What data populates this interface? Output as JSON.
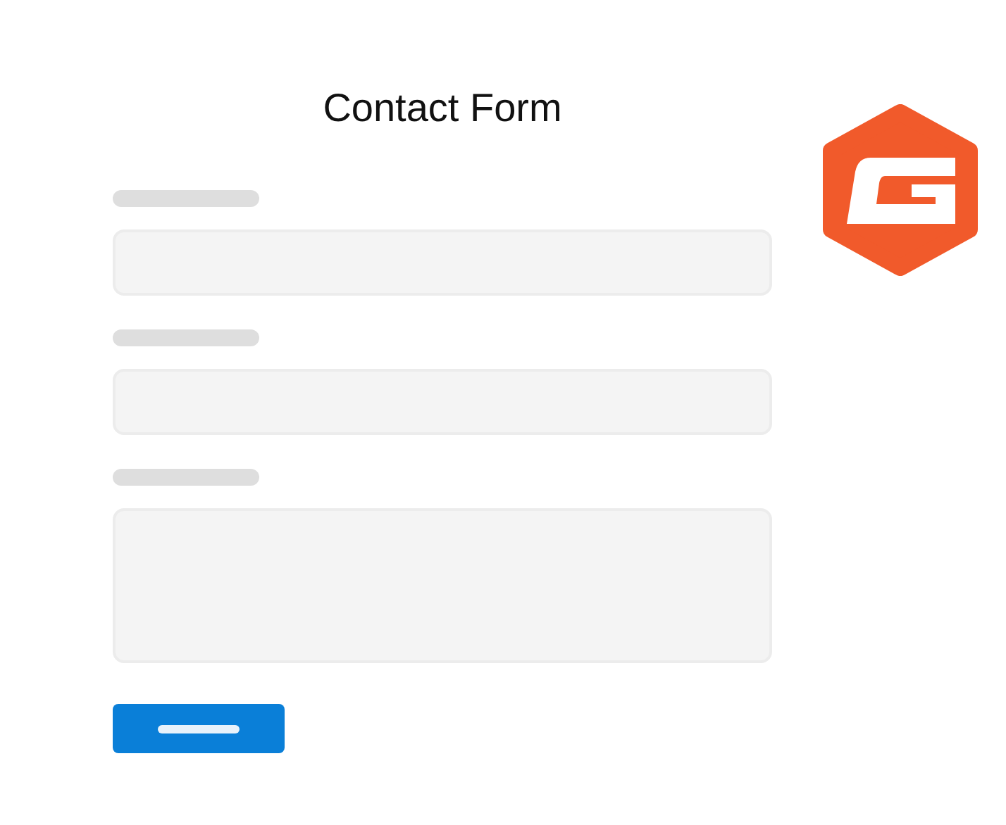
{
  "form": {
    "title": "Contact Form",
    "fields": [
      {
        "kind": "line"
      },
      {
        "kind": "line"
      },
      {
        "kind": "area"
      }
    ]
  }
}
